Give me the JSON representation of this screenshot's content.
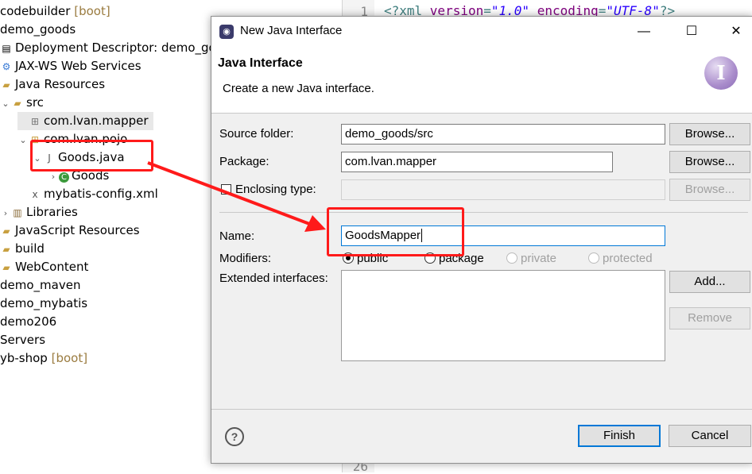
{
  "explorer": {
    "items": [
      {
        "label": "codebuilder",
        "decoration": "[boot]"
      },
      {
        "label": "demo_goods"
      },
      {
        "label": "Deployment Descriptor: demo_go"
      },
      {
        "label": "JAX-WS Web Services"
      },
      {
        "label": "Java Resources"
      },
      {
        "label": "src"
      },
      {
        "label": "com.lvan.mapper"
      },
      {
        "label": "com.lvan.pojo"
      },
      {
        "label": "Goods.java"
      },
      {
        "label": "Goods"
      },
      {
        "label": "mybatis-config.xml"
      },
      {
        "label": "Libraries"
      },
      {
        "label": "JavaScript Resources"
      },
      {
        "label": "build"
      },
      {
        "label": "WebContent"
      },
      {
        "label": "demo_maven"
      },
      {
        "label": "demo_mybatis"
      },
      {
        "label": "demo206"
      },
      {
        "label": "Servers"
      },
      {
        "label": "yb-shop",
        "decoration": "[boot]"
      }
    ]
  },
  "editor": {
    "line1_number": "1",
    "line1_tokens": [
      "<?xml ",
      "version",
      "=",
      "\"1.0\"",
      " ",
      "encoding",
      "=",
      "\"UTF-8\"",
      "?>"
    ],
    "last_line_number": "26"
  },
  "dialog": {
    "title": "New Java Interface",
    "window_buttons": {
      "minimize": "—",
      "maximize": "☐",
      "close": "✕"
    },
    "banner_title": "Java Interface",
    "banner_description": "Create a new Java interface.",
    "banner_icon_letter": "I",
    "source_folder": {
      "label": "Source folder:",
      "value": "demo_goods/src",
      "button": "Browse..."
    },
    "package": {
      "label": "Package:",
      "value": "com.lvan.mapper",
      "button": "Browse..."
    },
    "enclosing_type": {
      "label": "Enclosing type:",
      "value": "",
      "button": "Browse..."
    },
    "name": {
      "label": "Name:",
      "value": "GoodsMapper"
    },
    "modifiers": {
      "label": "Modifiers:",
      "options": [
        {
          "label": "public",
          "checked": true,
          "enabled": true
        },
        {
          "label": "package",
          "checked": false,
          "enabled": true
        },
        {
          "label": "private",
          "checked": false,
          "enabled": false
        },
        {
          "label": "protected",
          "checked": false,
          "enabled": false
        }
      ]
    },
    "extended_interfaces": {
      "label": "Extended interfaces:",
      "add_button": "Add...",
      "remove_button": "Remove"
    },
    "help_icon": "?",
    "finish_button": "Finish",
    "cancel_button": "Cancel"
  },
  "colors": {
    "annotation_red": "#ff1a1a",
    "default_button_border": "#0078d7",
    "banner_icon_purple": "#a98ccb"
  }
}
